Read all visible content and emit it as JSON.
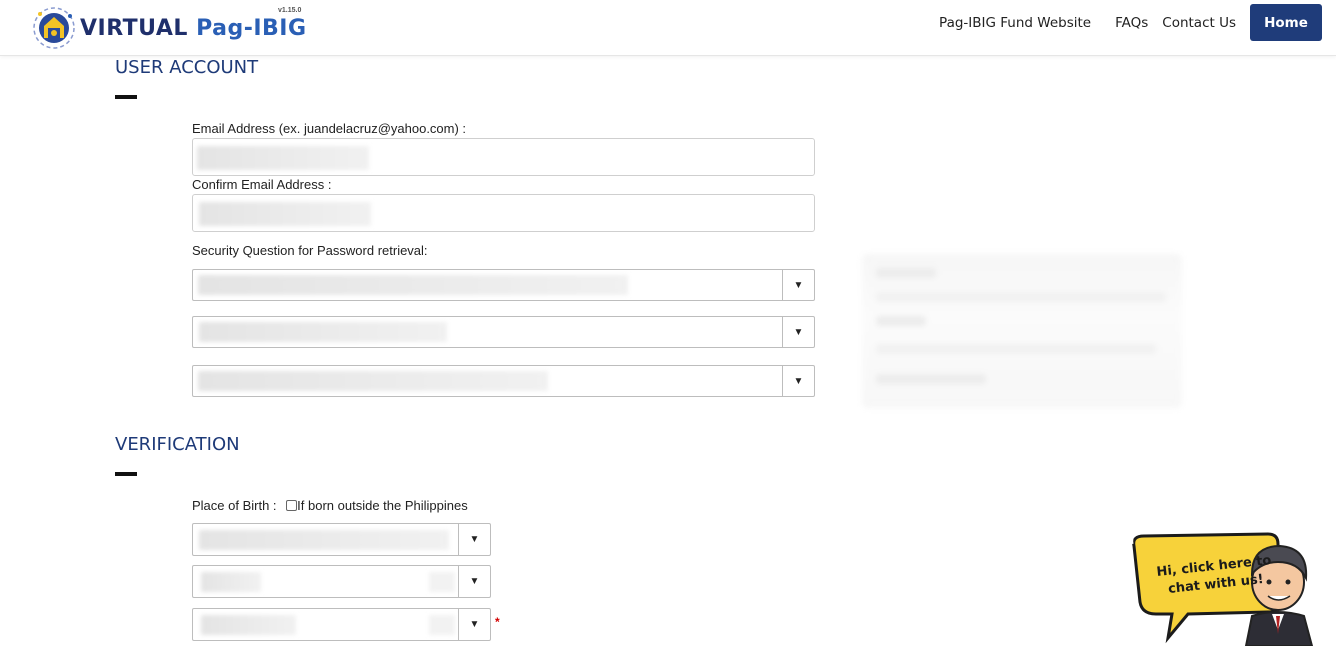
{
  "header": {
    "logo_virtual": "VIRTUAL",
    "logo_pagibig": "Pag-IBIG",
    "version": "v1.15.0",
    "nav": [
      "Pag-IBIG Fund Website",
      "FAQs",
      "Contact Us"
    ],
    "home_label": "Home"
  },
  "user_account": {
    "title": "USER ACCOUNT",
    "email_label": "Email Address (ex. juandelacruz@yahoo.com) :",
    "confirm_email_label": "Confirm Email Address :",
    "security_label": "Security Question for Password retrieval:"
  },
  "verification": {
    "title": "VERIFICATION",
    "place_of_birth_label": "Place of Birth :",
    "outside_ph_label": "If born outside the Philippines",
    "required_mark": "*"
  },
  "chat": {
    "line1": "Hi, click here to",
    "line2": "chat with us!"
  },
  "colors": {
    "brand_navy": "#1f3c7a",
    "section_title": "#1e3a78",
    "chat_yellow": "#f7d23a"
  }
}
